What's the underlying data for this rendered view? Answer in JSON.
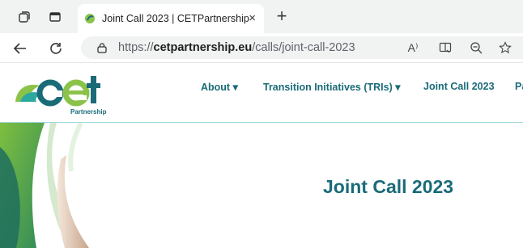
{
  "browser": {
    "tab": {
      "title": "Joint Call 2023 | CETPartnership",
      "close_glyph": "×"
    },
    "new_tab_glyph": "+",
    "address": {
      "scheme": "https://",
      "domain": "cetpartnership.eu",
      "path": "/calls/joint-call-2023"
    },
    "read_aloud_glyph": "A⁾"
  },
  "site": {
    "logo_text": "Partnership",
    "nav": [
      {
        "label": "About ▾"
      },
      {
        "label": "Transition Initiatives (TRIs) ▾"
      },
      {
        "label": "Joint Call 2023"
      },
      {
        "label": "Pa"
      }
    ]
  },
  "page": {
    "title": "Joint Call 2023"
  },
  "colors": {
    "brand_teal": "#1a6b78",
    "brand_green": "#8bc34a",
    "divider": "#9fd9dd"
  }
}
